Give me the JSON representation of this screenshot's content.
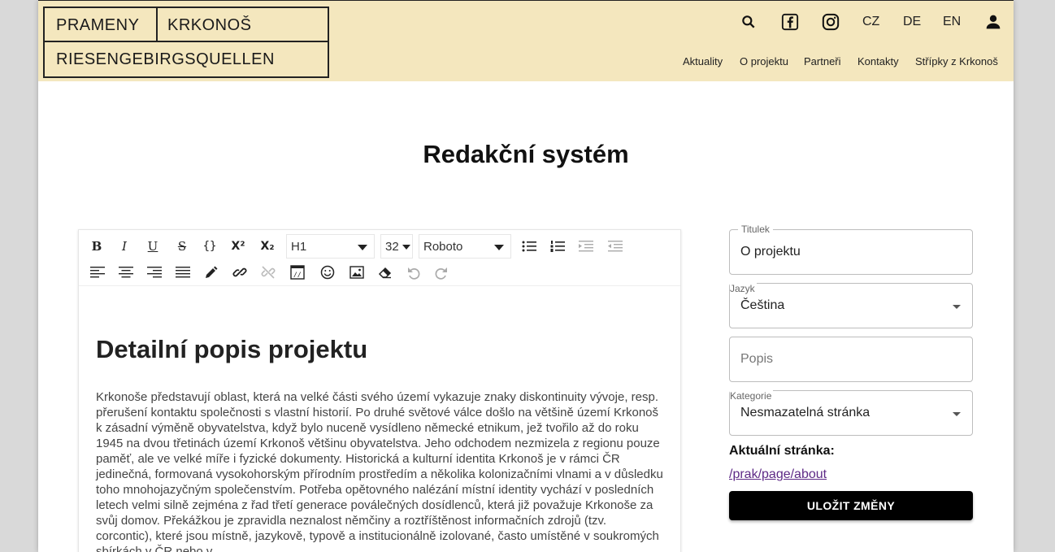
{
  "logo": {
    "line1_left": "PRAMENY",
    "line1_right": "KRKONOŠ",
    "line2": "RIESENGEBIRGSQUELLEN"
  },
  "header": {
    "icons": [
      "search-icon",
      "facebook-icon",
      "instagram-icon",
      "account-icon"
    ],
    "languages": [
      "CZ",
      "DE",
      "EN"
    ],
    "nav": [
      "Aktuality",
      "O projektu",
      "Partneři",
      "Kontakty",
      "Střípky z Krkonoš"
    ]
  },
  "page_title": "Redakční systém",
  "toolbar": {
    "bold": "B",
    "italic": "I",
    "underline": "U",
    "strike": "S",
    "code": "{}",
    "superscript": "X²",
    "subscript": "X₂",
    "block_format": "H1",
    "font_size": "32",
    "font_family": "Roboto"
  },
  "editor": {
    "heading": "Detailní popis projektu",
    "paragraph": "Krkonoše představují oblast, která na velké části svého území vykazuje znaky diskontinuity vývoje, resp. přerušení kontaktu společnosti s vlastní historií. Po druhé světové válce došlo na většině území Krkonoš k zásadní výměně obyvatelstva, když bylo nuceně vysídleno německé etnikum, jež tvořilo až do roku 1945 na dvou třetinách území Krkonoš většinu obyvatelstva. Jeho odchodem nezmizela z regionu pouze paměť, ale ve velké míře i fyzické dokumenty. Historická a kulturní identita Krkonoš je v rámci ČR jedinečná, formovaná vysokohorským přírodním prostředím a několika kolonizačními vlnami a v důsledku toho mnohojazyčným společenstvím. Potřeba opětovného nalézání místní identity vychází v posledních letech velmi silně zejména z řad třetí generace poválečných dosídlenců, která již považuje Krkonoše za svůj domov. Překážkou je zpravidla neznalost němčiny a roztříštěnost informačních zdrojů (tzv. corcontic), které jsou místně, jazykově, typově a institucionálně izolované, často umístěné v soukromých sbírkách v ČR nebo v"
  },
  "form": {
    "title_label": "Titulek",
    "title_value": "O projektu",
    "language_label": "Jazyk",
    "language_value": "Čeština",
    "description_placeholder": "Popis",
    "category_label": "Kategorie",
    "category_value": "Nesmazatelná stránka",
    "current_page_label": "Aktuální stránka:",
    "current_page_link": "/prak/page/about",
    "save_label": "ULOŽIT ZMĚNY"
  }
}
